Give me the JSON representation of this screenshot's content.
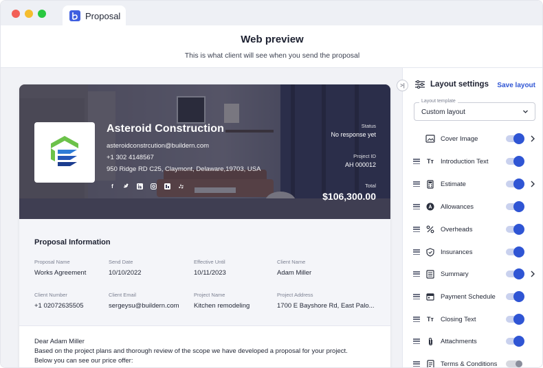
{
  "window": {
    "tab_label": "Proposal"
  },
  "header": {
    "title": "Web preview",
    "subtitle": "This is what client will see when you send the proposal"
  },
  "hero": {
    "company_name": "Asteroid Construction",
    "email": "asteroidconstrcution@buildern.com",
    "phone": "+1 302 4148567",
    "address": "950 Ridge RD C25, Claymont, Delaware,19703, USA",
    "status_label": "Status",
    "status_value": "No response yet",
    "project_id_label": "Project ID",
    "project_id_value": "AH 000012",
    "total_label": "Total",
    "total_value": "$106,300.00",
    "socials": [
      "facebook-icon",
      "twitter-icon",
      "linkedin-icon",
      "instagram-icon",
      "houzz-icon",
      "yelp-icon"
    ]
  },
  "proposal_info": {
    "title": "Proposal Information",
    "fields": [
      {
        "label": "Proposal Name",
        "value": "Works Agreement"
      },
      {
        "label": "Send Date",
        "value": "10/10/2022"
      },
      {
        "label": "Effective Until",
        "value": "10/11/2023"
      },
      {
        "label": "Client Name",
        "value": "Adam Miller"
      },
      {
        "label": "Client Number",
        "value": "+1 02072635505"
      },
      {
        "label": "Client Email",
        "value": "sergeysu@buildern.com"
      },
      {
        "label": "Project Name",
        "value": "Kitchen remodeling"
      },
      {
        "label": "Project Address",
        "value": "1700 E Bayshore Rd, East Palo..."
      }
    ]
  },
  "letter": {
    "greeting": "Dear Adam Miller",
    "line1": "Based on the project plans and thorough review of the scope we have developed a proposal for your project.",
    "line2": "Below you can see our price offer:"
  },
  "panel": {
    "title": "Layout settings",
    "save_label": "Save layout",
    "template_legend": "Layout template",
    "template_value": "Custom layout",
    "items": [
      {
        "label": "Cover Image",
        "icon": "image-icon",
        "on": true,
        "has_arrow": true,
        "draggable": false
      },
      {
        "label": "Introduction Text",
        "icon": "text-format-icon",
        "on": true,
        "has_arrow": false,
        "draggable": true
      },
      {
        "label": "Estimate",
        "icon": "calculator-icon",
        "on": true,
        "has_arrow": true,
        "draggable": true
      },
      {
        "label": "Allowances",
        "icon": "allowance-icon",
        "on": true,
        "has_arrow": false,
        "draggable": true
      },
      {
        "label": "Overheads",
        "icon": "percent-icon",
        "on": true,
        "has_arrow": false,
        "draggable": true
      },
      {
        "label": "Insurances",
        "icon": "shield-icon",
        "on": true,
        "has_arrow": false,
        "draggable": true
      },
      {
        "label": "Summary",
        "icon": "list-icon",
        "on": true,
        "has_arrow": true,
        "draggable": true
      },
      {
        "label": "Payment Schedule",
        "icon": "calendar-icon",
        "on": true,
        "has_arrow": false,
        "draggable": true
      },
      {
        "label": "Closing Text",
        "icon": "text-format-icon",
        "on": true,
        "has_arrow": false,
        "draggable": true
      },
      {
        "label": "Attachments",
        "icon": "paperclip-icon",
        "on": true,
        "has_arrow": false,
        "draggable": true
      },
      {
        "label": "Terms & Conditions",
        "icon": "document-icon",
        "on": false,
        "has_arrow": false,
        "draggable": true
      }
    ]
  },
  "colors": {
    "accent": "#2f55d4",
    "hero_overlay": "#2a2b45"
  }
}
